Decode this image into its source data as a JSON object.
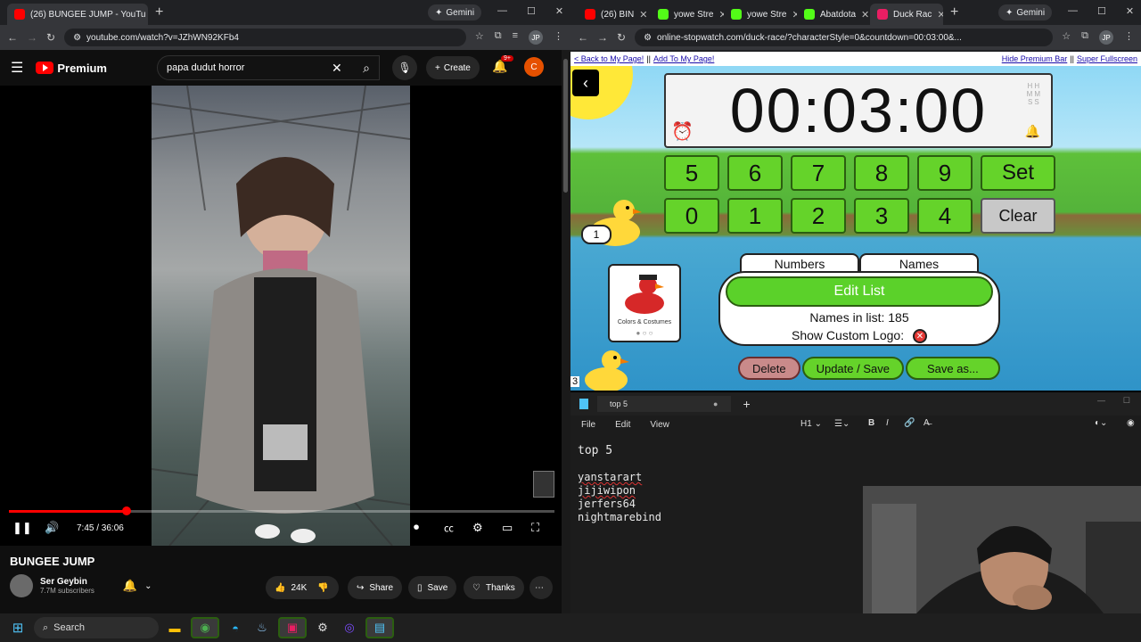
{
  "left_browser": {
    "tabs": [
      {
        "label": "(26) BUNGEE JUMP - YouTu",
        "active": true
      }
    ],
    "gemini_label": "Gemini",
    "url": "youtube.com/watch?v=JZhWN92KFb4",
    "profile_initials": "JP"
  },
  "youtube": {
    "logo_text": "Premium",
    "search_query": "papa dudut horror",
    "create_label": "Create",
    "notification_badge": "9+",
    "avatar_initial": "C",
    "time_display": "7:45 / 36:06",
    "progress_fraction": 0.215,
    "video_title": "BUNGEE JUMP",
    "channel_name": "Ser Geybin",
    "subscribers": "7.7M subscribers",
    "like_count": "24K",
    "share_label": "Share",
    "save_label": "Save",
    "thanks_label": "Thanks"
  },
  "right_browser": {
    "tabs": [
      {
        "label": "(26) BIN",
        "active": false
      },
      {
        "label": "yowe Stre",
        "active": false
      },
      {
        "label": "yowe Stre",
        "active": false
      },
      {
        "label": "Abatdota",
        "active": false
      },
      {
        "label": "Duck Rac",
        "active": true
      }
    ],
    "gemini_label": "Gemini",
    "url": "online-stopwatch.com/duck-race/?characterStyle=0&countdown=00:03:00&...",
    "profile_initials": "JP",
    "premium_links": {
      "back": "< Back to My Page!",
      "separator": "||",
      "add": "Add To My Page!",
      "hide": "Hide Premium Bar",
      "fullscreen": "Super Fullscreen"
    }
  },
  "duck_race": {
    "timer": "00:03:00",
    "hms_labels": [
      "HH",
      "MM",
      "SS"
    ],
    "keypad_row1": [
      "5",
      "6",
      "7",
      "8",
      "9",
      "Set"
    ],
    "keypad_row2": [
      "0",
      "1",
      "2",
      "3",
      "4",
      "Clear"
    ],
    "duck_numbers": [
      "1",
      "3"
    ],
    "tab_numbers": "Numbers",
    "tab_names": "Names",
    "edit_list": "Edit List",
    "names_count_label": "Names in list: 185",
    "custom_logo_label": "Show Custom Logo:",
    "costume_label": "Colors & Costumes",
    "actions": [
      "Delete",
      "Update / Save",
      "Save as..."
    ],
    "colors": {
      "green": "#65d32a",
      "delete": "#c98a8a"
    }
  },
  "notepad": {
    "tab_title": "top 5",
    "menu": [
      "File",
      "Edit",
      "View"
    ],
    "heading_style": "H1",
    "lines": [
      "top 5",
      "",
      "yanstarart",
      "jijiwipon",
      "jerfers64",
      "nightmarebind"
    ]
  },
  "taskbar": {
    "search_label": "Search"
  }
}
